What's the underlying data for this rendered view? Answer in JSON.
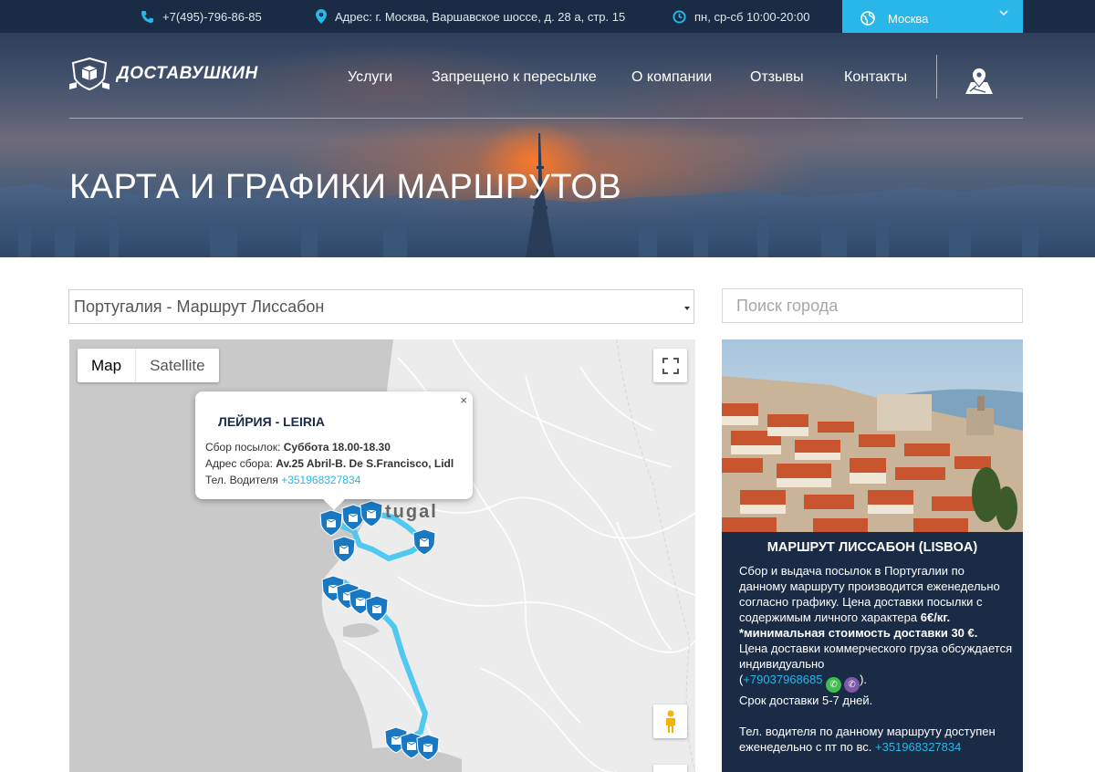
{
  "topbar": {
    "phone": "+7(495)-796-86-85",
    "address": "Адрес: г. Москва, Варшавское шоссе, д. 28 а, стр. 15",
    "hours": "пн, ср-сб 10:00-20:00",
    "city": "Москва"
  },
  "header": {
    "logo_text": "ДОСТАВУШКИН",
    "nav": [
      "Услуги",
      "Запрещено к пересылке",
      "О компании",
      "Отзывы",
      "Контакты"
    ],
    "page_title": "КАРТА И ГРАФИКИ МАРШРУТОВ"
  },
  "route_select": {
    "value": "Португалия - Маршрут Лиссабон"
  },
  "city_search": {
    "placeholder": "Поиск города"
  },
  "map": {
    "type_buttons": [
      "Map",
      "Satellite"
    ],
    "country_label": "tugal",
    "info_window": {
      "close": "×",
      "title": "ЛЕЙРИЯ - LEIRIA",
      "pickup_label": "Сбор посылок:",
      "pickup_value": "Суббота 18.00-18.30",
      "address_label": "Адрес сбора:",
      "address_value": "Av.25 Abril-B. De S.Francisco, Lidl",
      "phone_label": "Тел. Водителя",
      "phone_value": "+351968327834"
    }
  },
  "route_card": {
    "title": "МАРШРУТ ЛИССАБОН (LISBOA)",
    "para1": "Сбор и выдача посылок в Португалии по данному маршруту производится еженедельно согласно графику. Цена доставки посылки с содержимым личного характера",
    "price": "6€/кг.",
    "min_cost": "*минимальная стоимость доставки 30 €.",
    "commercial": "Цена доставки коммерческого груза обсуждается индивидуально",
    "phone": "+79037968685",
    "term": "Срок доставки 5-7 дней.",
    "driver_text": "Тел. водителя по данному маршруту доступен еженедельно с пт по вс.",
    "driver_phone": "+351968327834"
  },
  "colors": {
    "navy": "#1a2b45",
    "accent": "#29b6e8",
    "route_line": "#48c6f0",
    "marker": "#1a78c2"
  }
}
